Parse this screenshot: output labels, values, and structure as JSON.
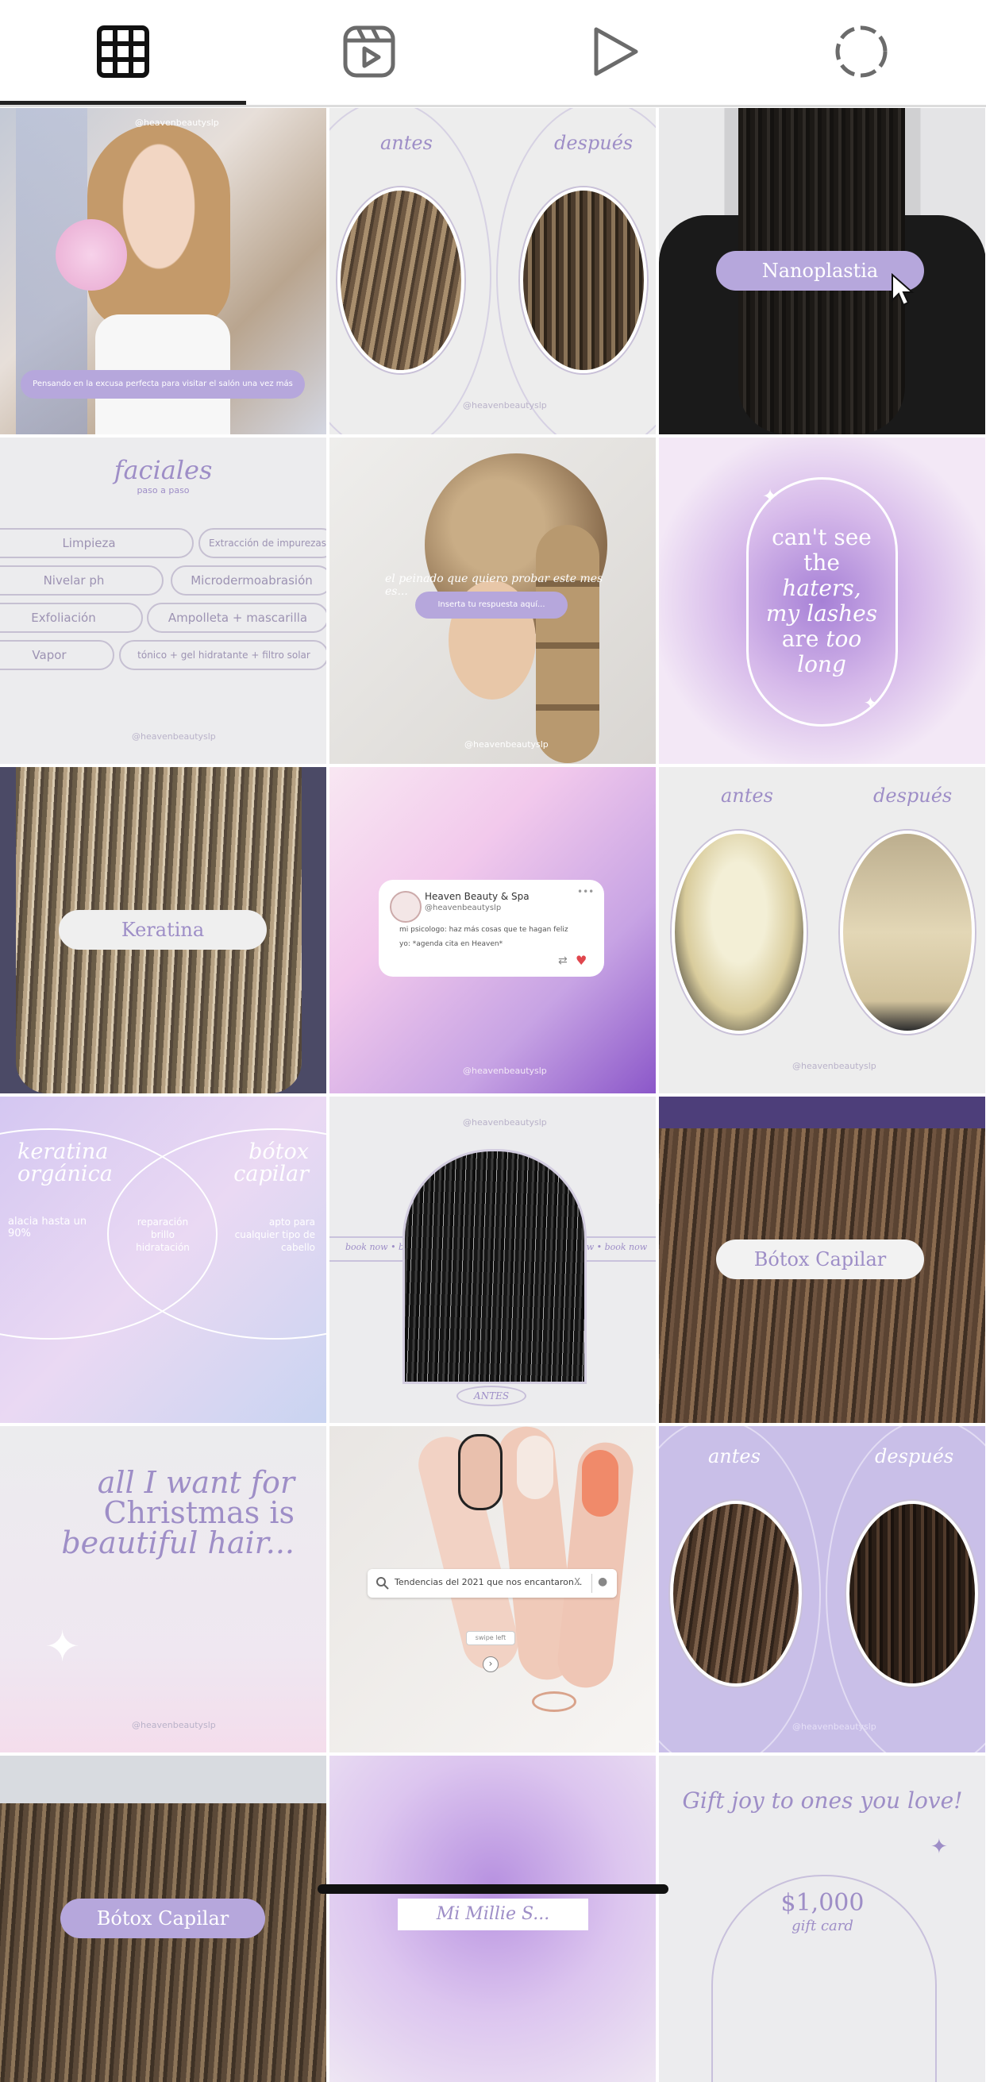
{
  "tabs": {
    "grid": {
      "icon": "grid-icon"
    },
    "reels": {
      "icon": "reels-icon"
    },
    "videos": {
      "icon": "play-icon"
    },
    "tagged": {
      "icon": "loading-circle-icon"
    }
  },
  "posts": {
    "p1": {
      "caption": "Pensando en la excusa perfecta para visitar el salón una vez más",
      "handle": "@heavenbeautyslp"
    },
    "p2": {
      "before": "antes",
      "after": "después",
      "handle": "@heavenbeautyslp"
    },
    "p3": {
      "label": "Nanoplastia"
    },
    "p4": {
      "title": "faciales",
      "subtitle": "paso a paso",
      "items": [
        "Limpieza",
        "Extracción de impurezas",
        "Nivelar ph",
        "Microdermoabrasión",
        "Exfoliación",
        "Ampolleta + mascarilla",
        "Vapor",
        "tónico + gel hidratante + filtro solar"
      ],
      "handle": "@heavenbeautyslp"
    },
    "p5": {
      "text": "el peinado que quiero probar este mes es...",
      "input": "Inserta tu respuesta aquí...",
      "handle": "@heavenbeautyslp"
    },
    "p6": {
      "l1": "can't see",
      "l2": "the",
      "l3": "haters,",
      "l4": "my lashes",
      "l5": "are",
      "l5b": "too",
      "l6": "long"
    },
    "p7": {
      "label": "Keratina"
    },
    "p8": {
      "name": "Heaven Beauty & Spa",
      "handle": "@heavenbeautyslp",
      "line1": "mi psicologo: haz más cosas que te hagan feliz",
      "line2": "yo: *agenda cita en Heaven*",
      "dots": "•••",
      "footer": "@heavenbeautyslp"
    },
    "p9": {
      "before": "antes",
      "after": "después",
      "handle": "@heavenbeautyslp"
    },
    "p10": {
      "left_title_1": "keratina",
      "left_title_2": "orgánica",
      "right_title_1": "bótox",
      "right_title_2": "capilar",
      "left_text_1": "alacia hasta un",
      "left_text_2": "90%",
      "center_1": "reparación",
      "center_2": "brillo",
      "center_3": "hidratación",
      "right_text_1": "apto para",
      "right_text_2": "cualquier tipo de",
      "right_text_3": "cabello"
    },
    "p11": {
      "handle": "@heavenbeautyslp",
      "ticker_left": "book now  •  boo",
      "ticker_right": "now  •  book now",
      "label": "ANTES"
    },
    "p12": {
      "label": "Bótox Capilar"
    },
    "p13": {
      "l1": "all I want for",
      "l2": "Christmas is",
      "l3": "beautiful hair...",
      "handle": "@heavenbeautyslp"
    },
    "p14": {
      "search": "Tendencias del 2021 que nos encantaron...",
      "clear": "X",
      "swipe": "swipe left",
      "arrow": "›"
    },
    "p15": {
      "before": "antes",
      "after": "después",
      "handle": "@heavenbeautyslp"
    },
    "p16": {
      "label": "Bótox Capilar"
    },
    "p17": {
      "label": "Mi Millie S..."
    },
    "p18": {
      "title": "Gift joy to ones you love!",
      "amount": "$1,000",
      "sub": "gift card"
    }
  },
  "colors": {
    "lavender": "#9e8ec7",
    "pill": "#b6a7dc",
    "tab_indicator": "#222222"
  }
}
